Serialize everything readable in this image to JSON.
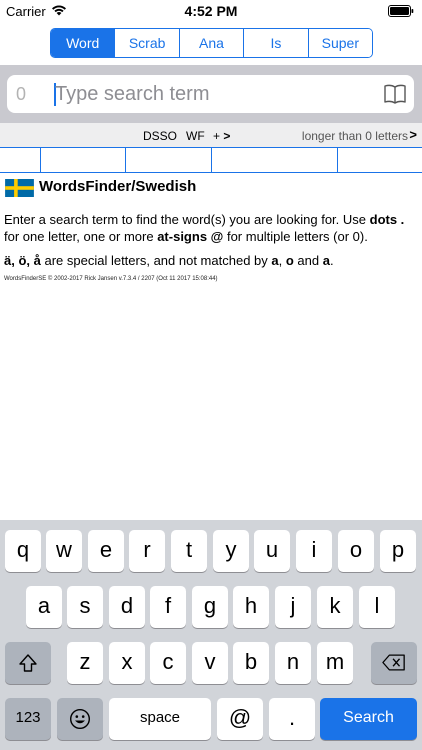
{
  "status_bar": {
    "carrier": "Carrier",
    "time": "4:52 PM"
  },
  "segments": [
    {
      "label": "Word",
      "active": true
    },
    {
      "label": "Scrab",
      "active": false
    },
    {
      "label": "Ana",
      "active": false
    },
    {
      "label": "Is",
      "active": false
    },
    {
      "label": "Super",
      "active": false
    }
  ],
  "search": {
    "count": "0",
    "placeholder": "Type search term",
    "value": ""
  },
  "options": {
    "dsso": "DSSO",
    "wf": "WF",
    "plus": "+",
    "chevron": ">",
    "length_label": "longer than 0 letters",
    "length_chevron": ">"
  },
  "info": {
    "title": "WordsFinder/Swedish",
    "line1_a": "Enter a search term to find the word(s) you are looking for. Use ",
    "line1_dots": "dots .",
    "line1_b": " for one letter, one or more ",
    "line1_at": "at-signs @",
    "line1_c": " for multiple letters (or 0).",
    "line2_a": "ä, ö, å",
    "line2_b": " are special letters, and not matched by ",
    "line2_c": "a",
    "line2_d": ", ",
    "line2_e": "o",
    "line2_f": " and ",
    "line2_g": "a",
    "line2_h": ".",
    "copyright": "WordsFinderSE © 2002-2017 Rick Jansen v.7.3.4 / 2207 (Oct 11 2017 15:08:44)"
  },
  "keyboard": {
    "row1": [
      "q",
      "w",
      "e",
      "r",
      "t",
      "y",
      "u",
      "i",
      "o",
      "p"
    ],
    "row2": [
      "a",
      "s",
      "d",
      "f",
      "g",
      "h",
      "j",
      "k",
      "l"
    ],
    "row3": [
      "z",
      "x",
      "c",
      "v",
      "b",
      "n",
      "m"
    ],
    "numbers": "123",
    "space": "space",
    "at": "@",
    "dot": ".",
    "search": "Search"
  },
  "colors": {
    "accent": "#1a73e8",
    "flag_blue": "#006aa7",
    "flag_yellow": "#fecc00"
  }
}
